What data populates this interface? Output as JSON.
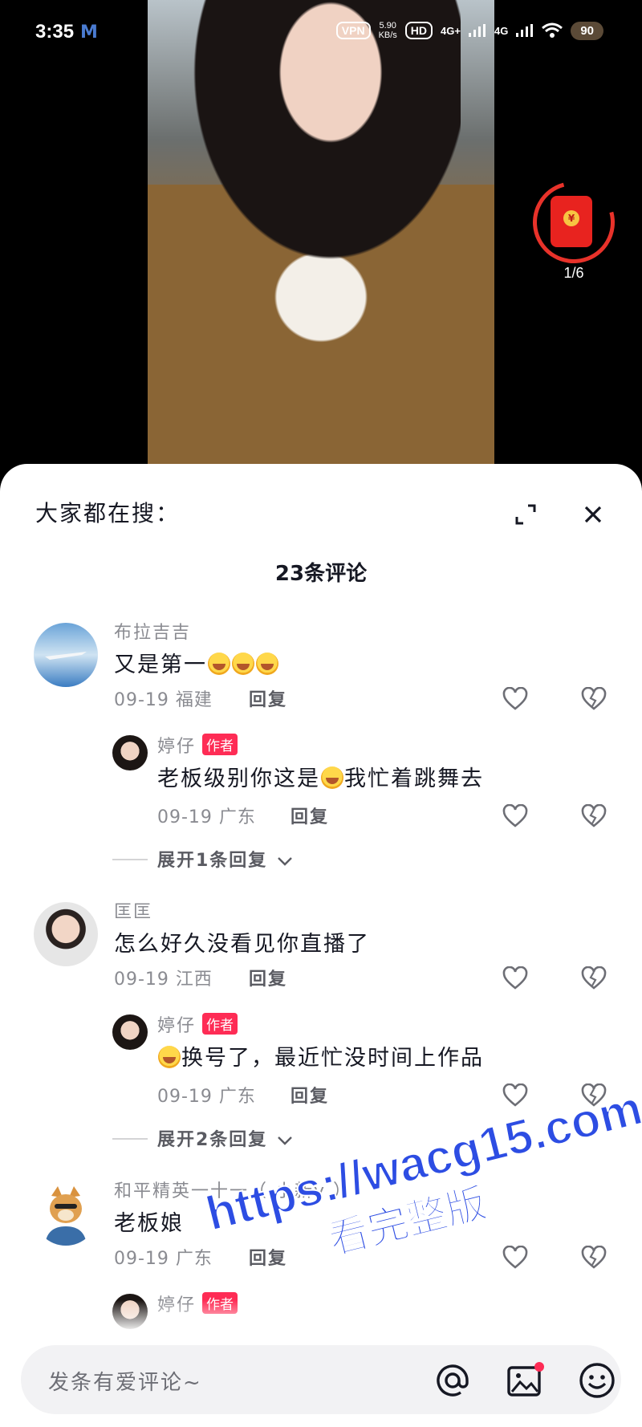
{
  "status_bar": {
    "time": "3:35",
    "vpn": "VPN",
    "speed_value": "5.90",
    "speed_unit": "KB/s",
    "hd": "HD",
    "net1": "4G+",
    "net2": "4G",
    "battery": "90"
  },
  "red_packet": {
    "count": "1/6",
    "coin_symbol": "¥"
  },
  "sheet": {
    "search_hint": "大家都在搜：",
    "comment_count": "23条评论"
  },
  "comments": [
    {
      "username": "布拉吉吉",
      "text": "又是第一",
      "emoji_count": 3,
      "date_location": "09-19 福建",
      "reply_label": "回复",
      "author_reply": {
        "username": "婷仔",
        "author_tag": "作者",
        "text_before": "老板级别你这是",
        "text_after": "我忙着跳舞去",
        "date_location": "09-19 广东",
        "reply_label": "回复"
      },
      "expand_label": "展开1条回复"
    },
    {
      "username": "匡匡",
      "text": "怎么好久没看见你直播了",
      "date_location": "09-19 江西",
      "reply_label": "回复",
      "author_reply": {
        "username": "婷仔",
        "author_tag": "作者",
        "text_after": "换号了，最近忙没时间上作品",
        "date_location": "09-19 广东",
        "reply_label": "回复"
      },
      "expand_label": "展开2条回复"
    },
    {
      "username": "和平精英一十一（ 小新y ）",
      "text": "老板娘",
      "date_location": "09-19 广东",
      "reply_label": "回复",
      "author_reply": {
        "username": "婷仔",
        "author_tag": "作者"
      }
    }
  ],
  "input": {
    "placeholder": "发条有爱评论~"
  },
  "watermark": {
    "line1": "https://wacg15.com",
    "line2": "看完整版"
  },
  "colors": {
    "accent": "#fe2c55",
    "watermark": "#2d4de3",
    "text": "#161823",
    "muted": "#8a8b91"
  }
}
